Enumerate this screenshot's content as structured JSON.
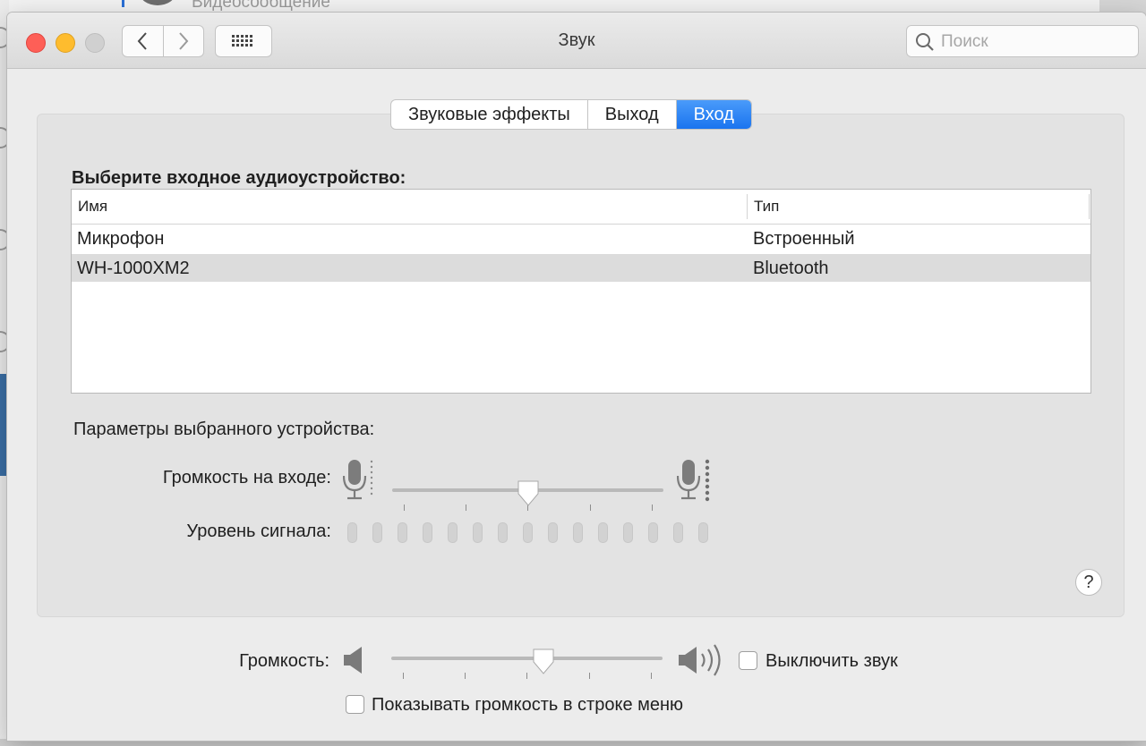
{
  "background": {
    "window_text": "Видеосообщение"
  },
  "window": {
    "title": "Звук",
    "search_placeholder": "Поиск",
    "icons": [
      "close-button",
      "minimize-button",
      "zoom-button",
      "chevron-left-icon",
      "chevron-right-icon",
      "grid-icon",
      "search-icon"
    ]
  },
  "tabs": [
    {
      "label": "Звуковые эффекты",
      "active": false
    },
    {
      "label": "Выход",
      "active": false
    },
    {
      "label": "Вход",
      "active": true
    }
  ],
  "input": {
    "heading": "Выберите входное аудиоустройство:",
    "table": {
      "columns": [
        "Имя",
        "Тип"
      ],
      "rows": [
        {
          "name": "Микрофон",
          "type": "Встроенный",
          "selected": false
        },
        {
          "name": "WH-1000XM2",
          "type": "Bluetooth",
          "selected": true
        }
      ]
    },
    "params_heading": "Параметры выбранного устройства:",
    "input_volume_label": "Громкость на входе:",
    "input_volume_level": 0.5,
    "signal_level_label": "Уровень сигнала:",
    "signal_level_active_segments": 0,
    "signal_level_segments": 15
  },
  "output": {
    "volume_label": "Громкость:",
    "volume_level": 0.56,
    "mute_label": "Выключить звук",
    "mute_checked": false,
    "show_in_menu_label": "Показывать громкость в строке меню",
    "show_in_menu_checked": false
  },
  "help_label": "?",
  "colors": {
    "accent": "#1a74ef",
    "close": "#fe5f57",
    "minimize": "#febc2e"
  }
}
